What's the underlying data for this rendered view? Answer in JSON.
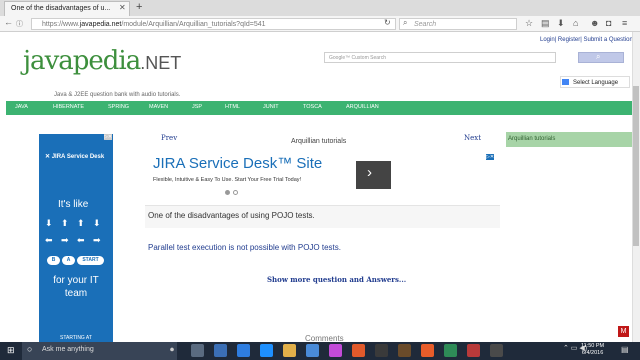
{
  "browser": {
    "tab_title": "One of the disadvantages of u...",
    "url_prefix": "https://www.",
    "url_domain": "javapedia.net",
    "url_path": "/module/Arquillian/Arquillian_tutorials?qId=541",
    "search_placeholder": "Search"
  },
  "header": {
    "logo_text": "javapedia",
    "logo_suffix": ".NET",
    "tagline": "Java & J2EE question bank with audio tutorials.",
    "auth_links": "Login| Register| Submit a Question",
    "google_search_placeholder": "Google™ Custom Search",
    "language_select": "Select Language"
  },
  "nav": {
    "items": [
      "JAVA",
      "HIBERNATE",
      "SPRING",
      "MAVEN",
      "JSP",
      "HTML",
      "JUNIT",
      "TOSCA",
      "ARQUILLIAN"
    ]
  },
  "ad_left": {
    "brand": "JIRA Service Desk",
    "headline": "It's like",
    "b_label": "B",
    "a_label": "A",
    "start_label": "START",
    "tagline": "for your IT team",
    "footer": "STARTING AT"
  },
  "content": {
    "prev_label": "Prev",
    "breadcrumb": "Arquillian tutorials",
    "next_label": "Next",
    "jira_title": "JIRA Service Desk™ Site",
    "jira_desc": "Flexible, Intuitive & Easy To Use. Start Your Free Trial Today!",
    "question": "One of the disadvantages of using POJO tests.",
    "answer": "Parallel test execution is not possible with POJO tests.",
    "show_more": "Show more question and Answers...",
    "comments": "Comments"
  },
  "sidebar_right": {
    "title": "Arquillian tutorials"
  },
  "taskbar": {
    "search_placeholder": "Ask me anything",
    "time": "11:50 PM",
    "date": "6/4/2016"
  },
  "colors": {
    "nav_green": "#3cb371",
    "ad_blue": "#1a6fb8",
    "taskbar": "#1f2a3a",
    "link_blue": "#223d8f"
  }
}
